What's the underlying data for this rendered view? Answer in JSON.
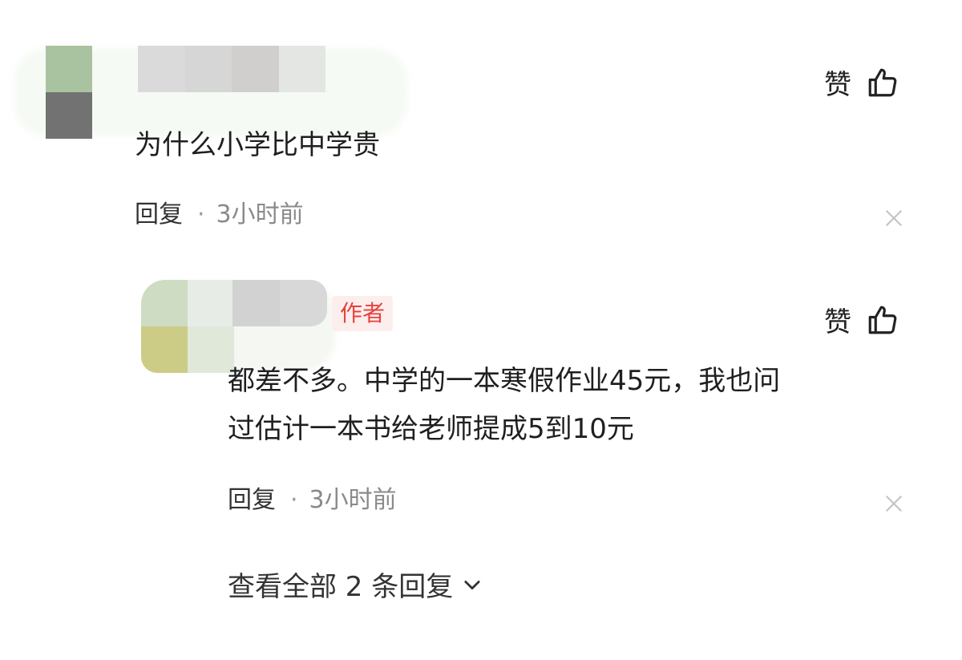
{
  "comments": [
    {
      "text": "为什么小学比中学贵",
      "like_label": "赞",
      "reply_label": "回复",
      "separator": "·",
      "time": "3小时前"
    }
  ],
  "replies": [
    {
      "author_badge": "作者",
      "text_line1": "都差不多。中学的一本寒假作业45元，我也问",
      "text_line2": "过估计一本书给老师提成5到10元",
      "like_label": "赞",
      "reply_label": "回复",
      "separator": "·",
      "time": "3小时前"
    }
  ],
  "view_all": {
    "label": "查看全部 2 条回复"
  },
  "icons": {
    "like": "thumbs-up-icon",
    "close": "close-icon",
    "expand": "chevron-down-icon"
  },
  "colors": {
    "author_badge_bg": "#fdeeee",
    "author_badge_text": "#e8413c",
    "meta_text": "#8a8a8a"
  }
}
